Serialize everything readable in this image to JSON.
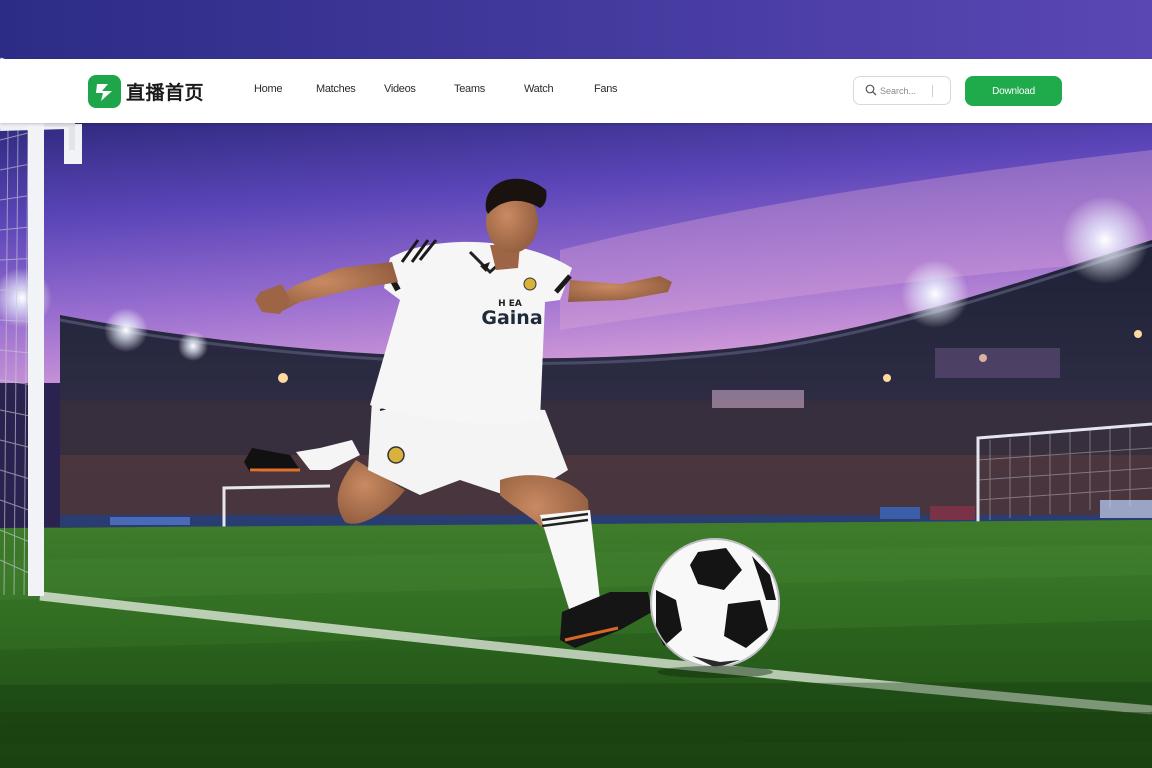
{
  "header": {
    "logo_text": "直播首页",
    "nav": [
      {
        "label": "Home"
      },
      {
        "label": "Matches"
      },
      {
        "label": "Videos"
      },
      {
        "label": "Teams"
      },
      {
        "label": "Watch"
      },
      {
        "label": "Fans"
      }
    ],
    "search": {
      "placeholder": "Search..."
    },
    "cta_label": "Download"
  },
  "player": {
    "jersey_text": "Gaina",
    "jersey_small_text": "H EA"
  },
  "colors": {
    "brand_green": "#1faa4b",
    "sky_top": "#3a2f8a",
    "sky_bottom": "#c58bd9",
    "pitch": "#2f6b22"
  },
  "icons": {
    "logo": "play-arrow-icon",
    "search": "search-icon"
  }
}
